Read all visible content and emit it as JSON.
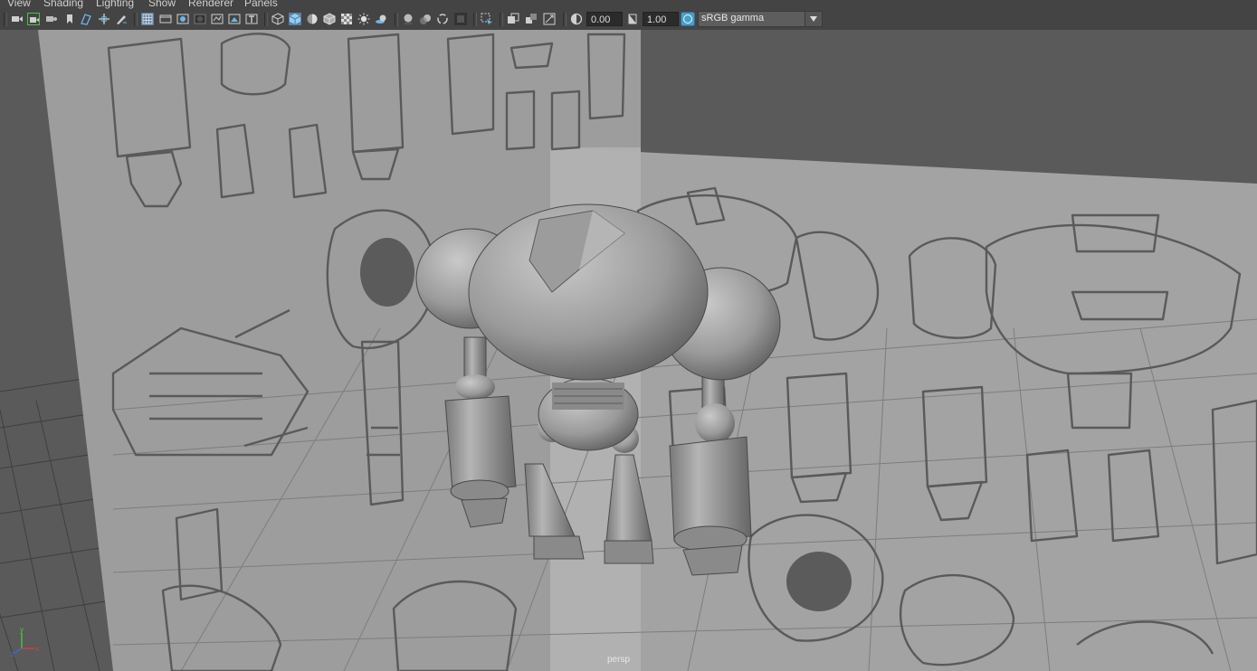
{
  "menubar": {
    "items": [
      "View",
      "Shading",
      "Lighting",
      "Show",
      "Renderer",
      "Panels"
    ]
  },
  "toolbar": {
    "camera_icons": [
      "camera-icon",
      "camera-attributes-icon",
      "camera-bookmark-icon",
      "bookmark-icon",
      "image-plane-icon",
      "pan-zoom-icon",
      "grease-pencil-icon"
    ],
    "display_icons": [
      "grid-icon",
      "film-gate-icon",
      "resolution-gate-icon",
      "gate-mask-icon",
      "field-chart-icon",
      "safe-action-icon",
      "safe-title-icon"
    ],
    "shading_icons": [
      "wireframe-icon",
      "smooth-shade-icon",
      "wireframe-on-shaded-icon",
      "default-material-icon",
      "textured-icon",
      "use-lights-icon",
      "shadows-icon"
    ],
    "effects_icons": [
      "ambient-occlusion-icon",
      "motion-blur-icon",
      "anti-aliasing-icon",
      "depth-of-field-icon"
    ],
    "misc_icons": [
      "isolate-select-icon",
      "xray-icon",
      "xray-joints-icon",
      "xray-active-icon"
    ],
    "exposure_value": "0.00",
    "gamma_value": "1.00",
    "color_space": "sRGB gamma"
  },
  "viewport": {
    "camera_label": "persp",
    "axis": {
      "x": "x",
      "y": "y",
      "z": "z"
    }
  }
}
